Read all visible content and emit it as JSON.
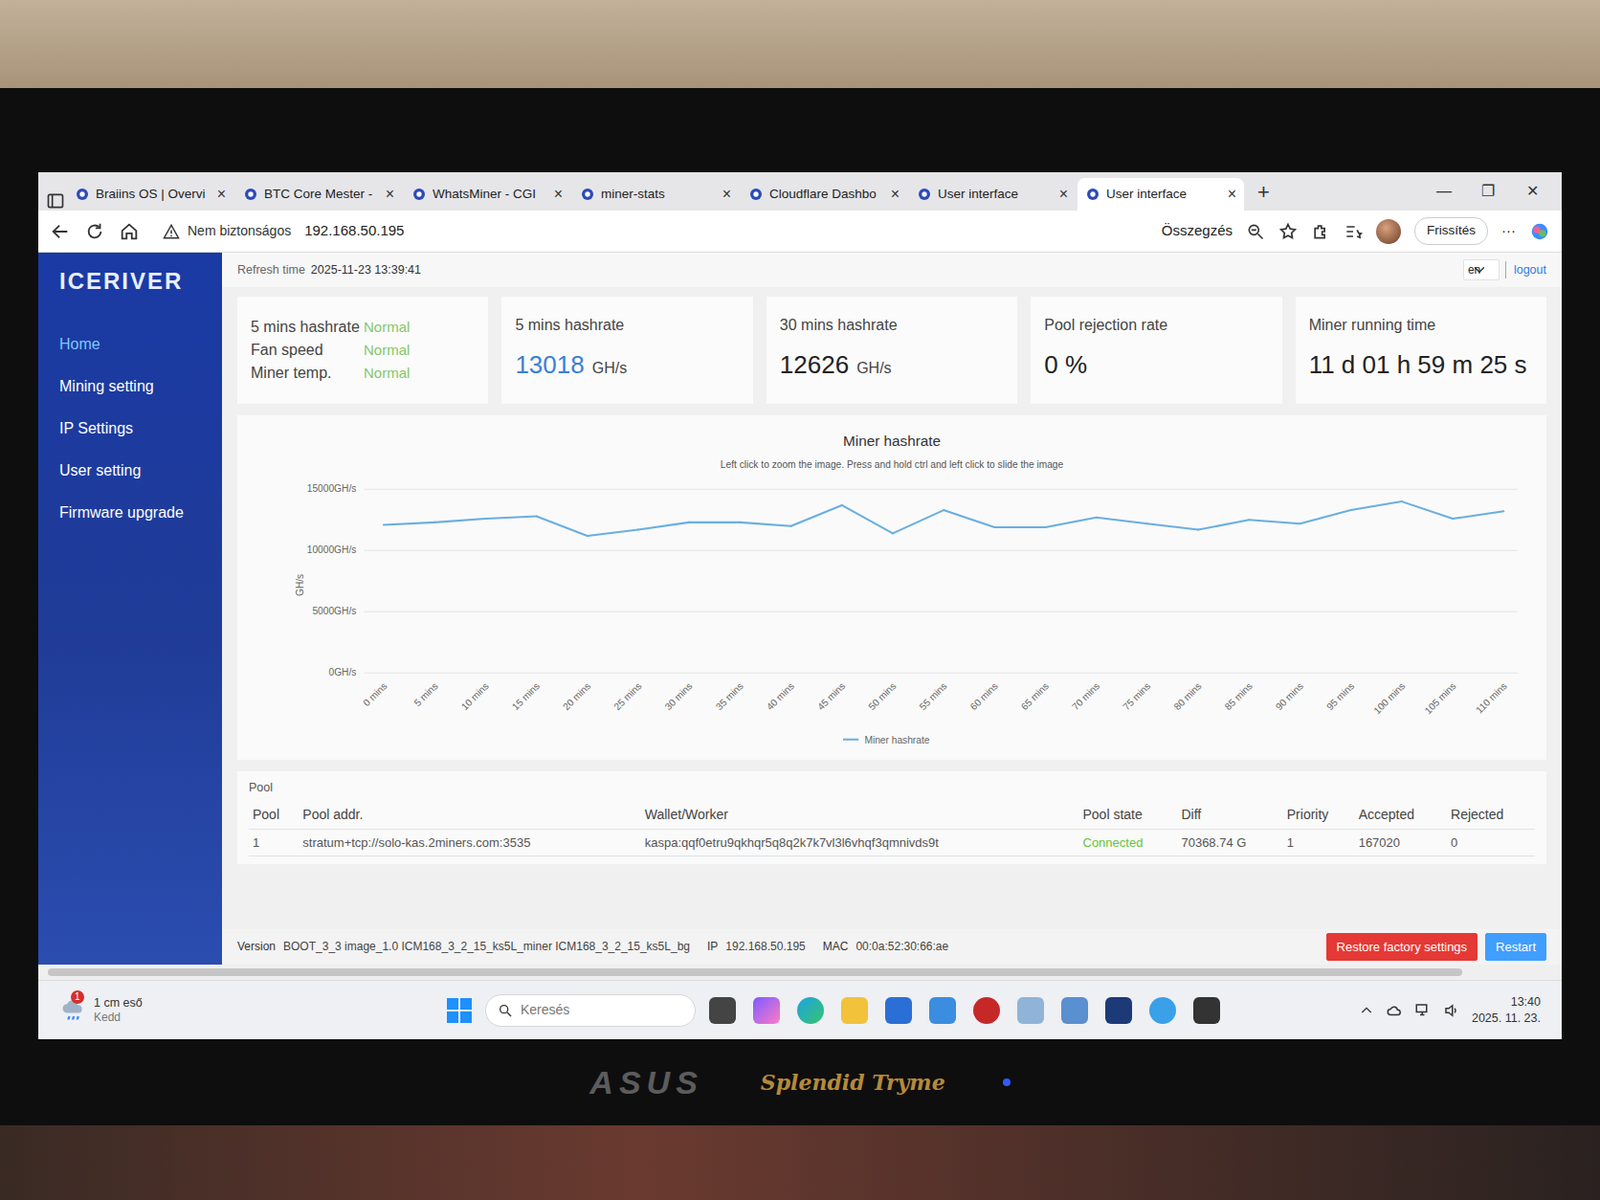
{
  "browser": {
    "tabs": [
      {
        "label": "Braiins OS | Overvi",
        "selected": false
      },
      {
        "label": "BTC Core Mester -",
        "selected": false
      },
      {
        "label": "WhatsMiner - CGI",
        "selected": false
      },
      {
        "label": "miner-stats",
        "selected": false
      },
      {
        "label": "Cloudflare Dashbo",
        "selected": false
      },
      {
        "label": "User interface",
        "selected": false
      },
      {
        "label": "User interface",
        "selected": true
      }
    ],
    "tab_close": "×",
    "new_tab": "+",
    "window_buttons": [
      "—",
      "❐",
      "✕"
    ],
    "address": {
      "security": "Nem biztonságos",
      "url": "192.168.50.195",
      "summary": "Összegzés",
      "refresh": "Frissítés",
      "more": "···"
    }
  },
  "sidebar": {
    "logo": "ICERIVER",
    "items": [
      {
        "label": "Home",
        "selected": true
      },
      {
        "label": "Mining setting",
        "selected": false
      },
      {
        "label": "IP Settings",
        "selected": false
      },
      {
        "label": "User setting",
        "selected": false
      },
      {
        "label": "Firmware upgrade",
        "selected": false
      }
    ]
  },
  "topbar": {
    "refresh_label": "Refresh time",
    "refresh_time": "2025-11-23 13:39:41",
    "language": "en",
    "logout": "logout"
  },
  "status": [
    {
      "label": "5 mins hashrate",
      "state": "Normal"
    },
    {
      "label": "Fan speed",
      "state": "Normal"
    },
    {
      "label": "Miner temp.",
      "state": "Normal"
    }
  ],
  "stats": [
    {
      "title": "5 mins hashrate",
      "value": "13018",
      "unit": "GH/s",
      "kind": "highlight"
    },
    {
      "title": "30 mins hashrate",
      "value": "12626",
      "unit": "GH/s",
      "kind": "plain"
    },
    {
      "title": "Pool rejection rate",
      "value": "0 %",
      "kind": "plain"
    },
    {
      "title": "Miner running time",
      "value": "11 d 01 h 59 m 25 s",
      "kind": "plain"
    }
  ],
  "chart": {
    "title": "Miner hashrate",
    "hint": "Left click to zoom the image. Press and hold ctrl and left click to slide the image",
    "y_axis": "GH/s",
    "y_ticks": [
      "15000GH/s",
      "10000GH/s",
      "5000GH/s",
      "0GH/s"
    ],
    "x_ticks": [
      "0 mins",
      "5 mins",
      "10 mins",
      "15 mins",
      "20 mins",
      "25 mins",
      "30 mins",
      "35 mins",
      "40 mins",
      "45 mins",
      "50 mins",
      "55 mins",
      "60 mins",
      "65 mins",
      "70 mins",
      "75 mins",
      "80 mins",
      "85 mins",
      "90 mins",
      "95 mins",
      "100 mins",
      "105 mins",
      "110 mins"
    ],
    "series": [
      {
        "name": "Miner hashrate",
        "values": [
          12100,
          12300,
          12600,
          12800,
          11200,
          11700,
          12300,
          12300,
          12000,
          13700,
          11400,
          13300,
          11900,
          11900,
          12700,
          12200,
          11700,
          12500,
          12200,
          13300,
          14000,
          12600,
          13200
        ]
      }
    ]
  },
  "pool": {
    "heading": "Pool",
    "columns": [
      "Pool",
      "Pool addr.",
      "Wallet/Worker",
      "Pool state",
      "Diff",
      "Priority",
      "Accepted",
      "Rejected"
    ],
    "rows": [
      {
        "cells": [
          "1",
          "stratum+tcp://solo-kas.2miners.com:3535",
          "kaspa:qqf0etru9qkhqr5q8q2k7k7vl3l6vhqf3qmnivds9t",
          "Connected",
          "70368.74 G",
          "1",
          "167020",
          "0"
        ],
        "connected": true
      }
    ]
  },
  "footer": {
    "version_label": "Version",
    "version": "BOOT_3_3 image_1.0 ICM168_3_2_15_ks5L_miner ICM168_3_2_15_ks5L_bg",
    "ip_label": "IP",
    "ip": "192.168.50.195",
    "mac_label": "MAC",
    "mac": "00:0a:52:30:66:ae",
    "buttons": [
      {
        "label": "Restore factory settings",
        "kind": "danger"
      },
      {
        "label": "Restart",
        "kind": "primary"
      }
    ]
  },
  "taskbar": {
    "weather": "1 cm eső",
    "weather_sub": "Kedd",
    "badge": "1",
    "search": "Keresés",
    "time": "13:40",
    "date": "2025. 11. 23."
  },
  "monitor": {
    "brand": "ASUS",
    "badge": "Splendid Tryme"
  }
}
